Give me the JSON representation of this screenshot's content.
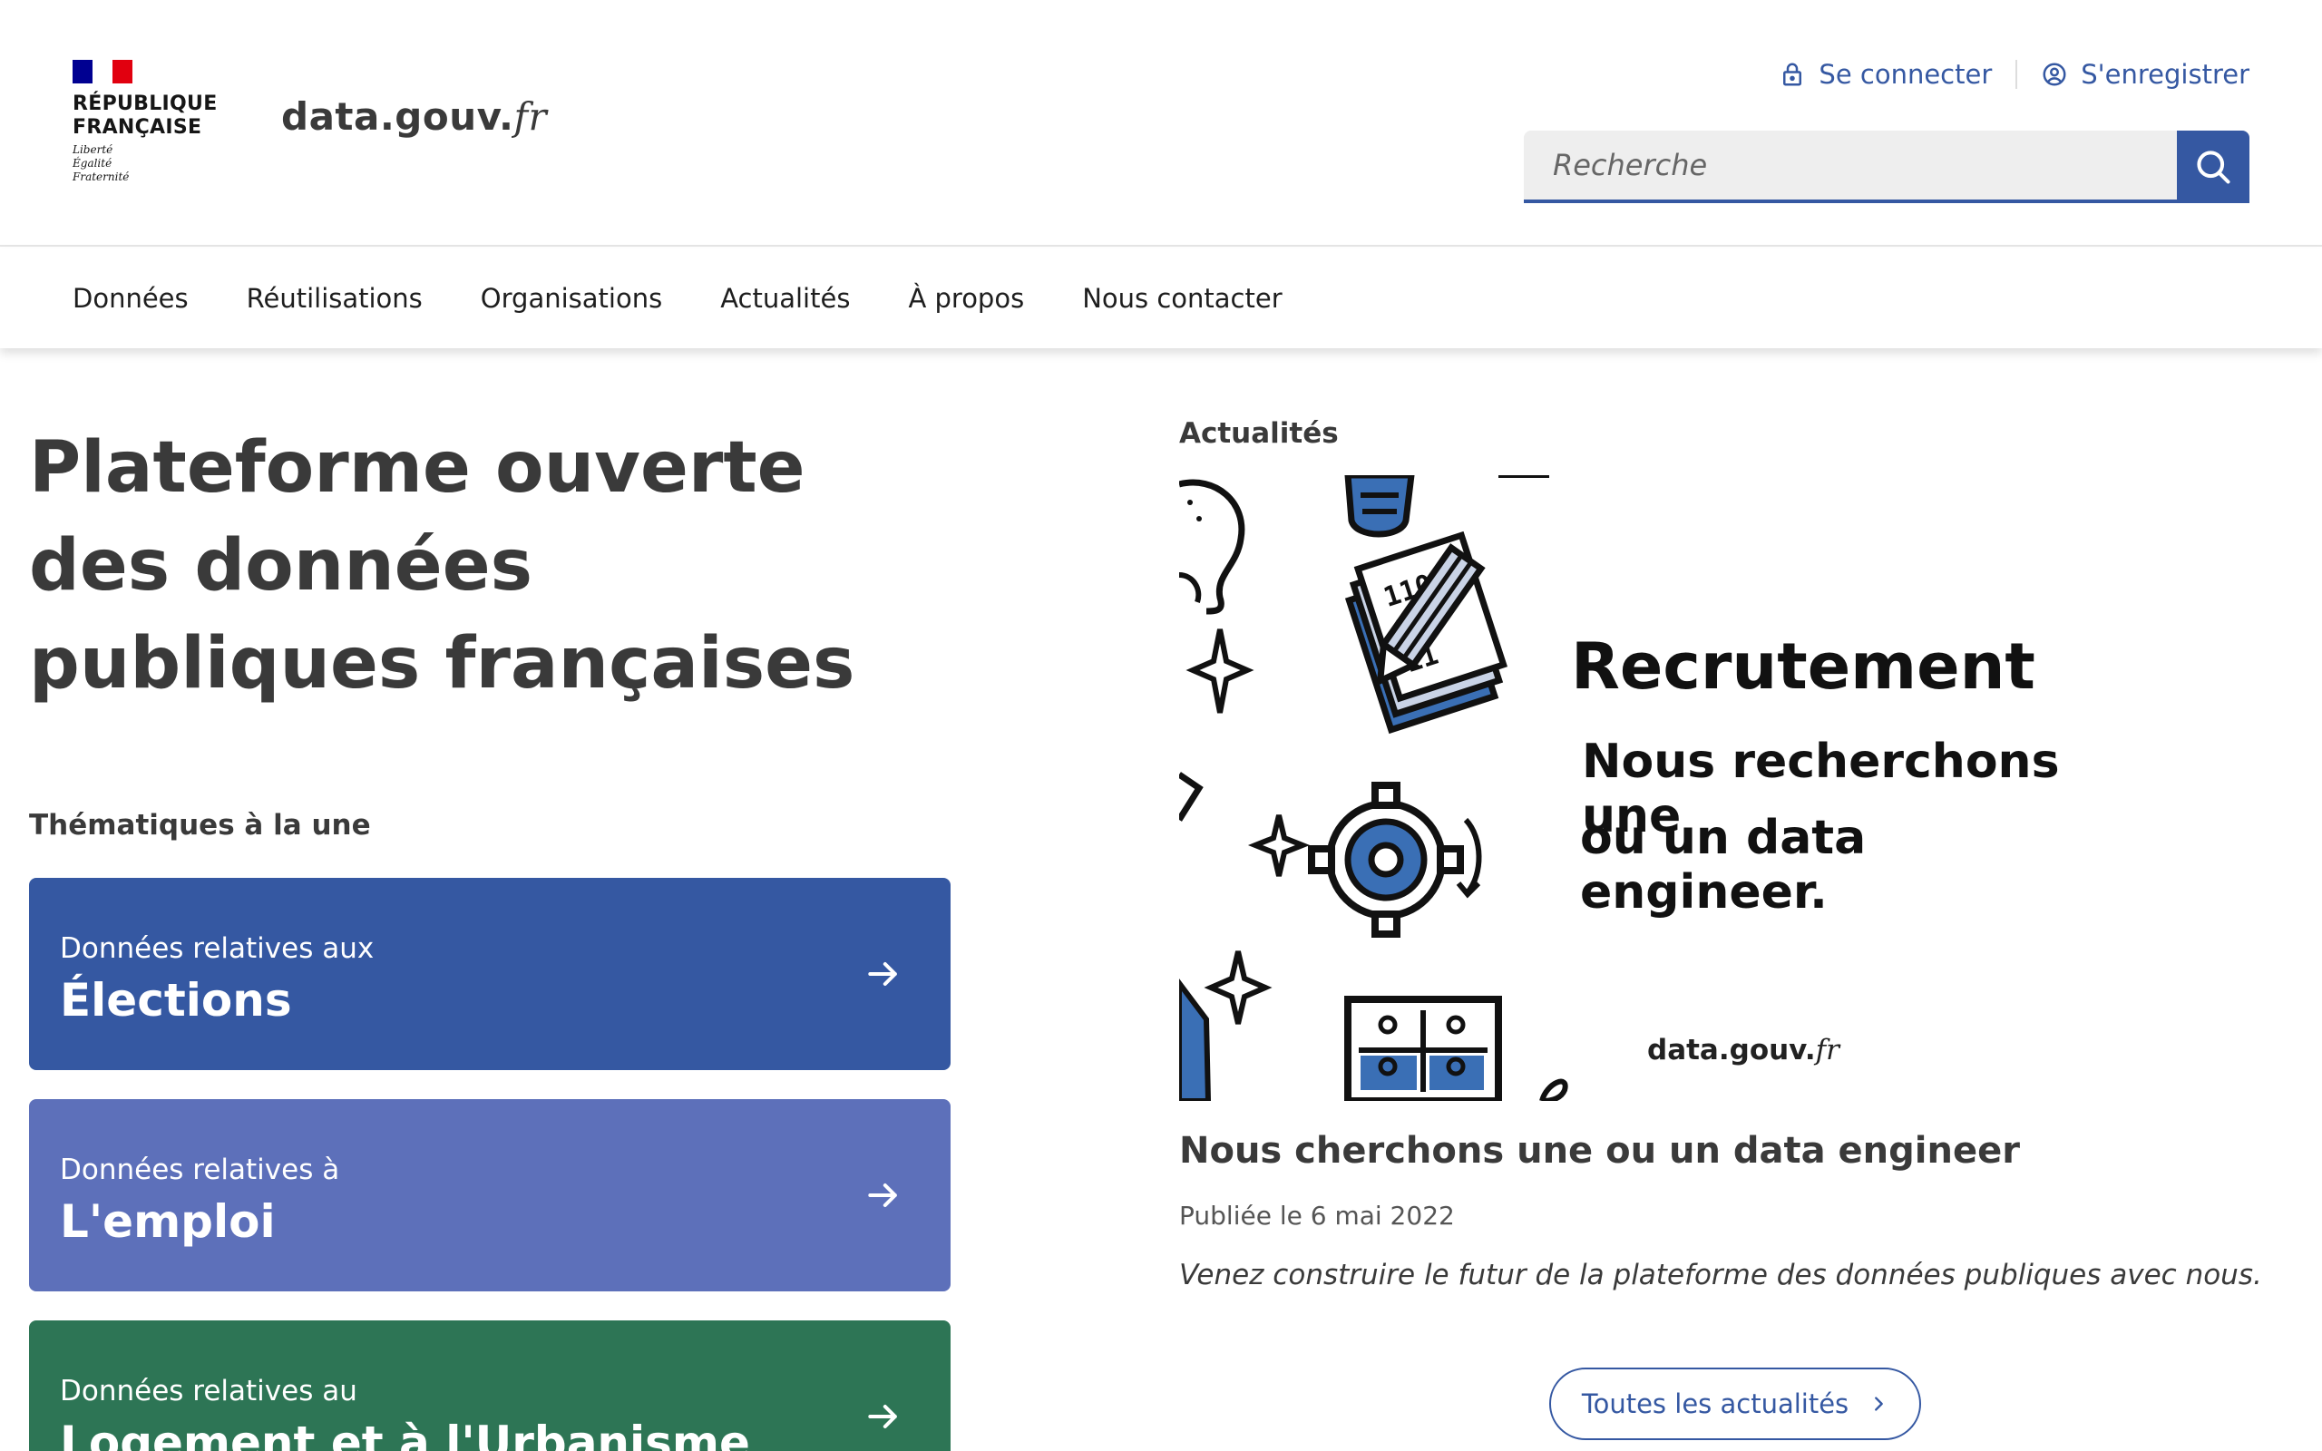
{
  "header": {
    "republic_line1": "RÉPUBLIQUE",
    "republic_line2": "FRANÇAISE",
    "motto_1": "Liberté",
    "motto_2": "Égalité",
    "motto_3": "Fraternité",
    "site_name_main": "data.gouv.",
    "site_name_suffix": "fr",
    "login_label": "Se connecter",
    "register_label": "S'enregistrer",
    "search_placeholder": "Recherche"
  },
  "nav": {
    "items": [
      {
        "label": "Données"
      },
      {
        "label": "Réutilisations"
      },
      {
        "label": "Organisations"
      },
      {
        "label": "Actualités"
      },
      {
        "label": "À propos"
      },
      {
        "label": "Nous contacter"
      }
    ]
  },
  "hero": {
    "title": "Plateforme ouverte des données publiques françaises"
  },
  "thematiques": {
    "heading": "Thématiques à la une",
    "cards": [
      {
        "subtitle": "Données relatives aux",
        "title": "Élections",
        "color": "#3558a2"
      },
      {
        "subtitle": "Données relatives à",
        "title": "L'emploi",
        "color": "#5d70ba"
      },
      {
        "subtitle": "Données relatives au",
        "title": "Logement et à l'Urbanisme",
        "color": "#2d7555"
      }
    ]
  },
  "news": {
    "heading": "Actualités",
    "image": {
      "headline": "Recrutement",
      "line1": "Nous recherchons une",
      "line2": "ou un data engineer.",
      "brand_main": "data.gouv.",
      "brand_suffix": "fr"
    },
    "title": "Nous cherchons une ou un data engineer",
    "date": "Publiée le 6 mai 2022",
    "description": "Venez construire le futur de la plateforme des données publiques avec nous.",
    "all_news_label": "Toutes les actualités"
  },
  "colors": {
    "primary": "#3558a2",
    "card_blue": "#3558a2",
    "card_purple": "#5d70ba",
    "card_green": "#2d7555",
    "flag_blue": "#000091",
    "flag_red": "#e1000f"
  }
}
